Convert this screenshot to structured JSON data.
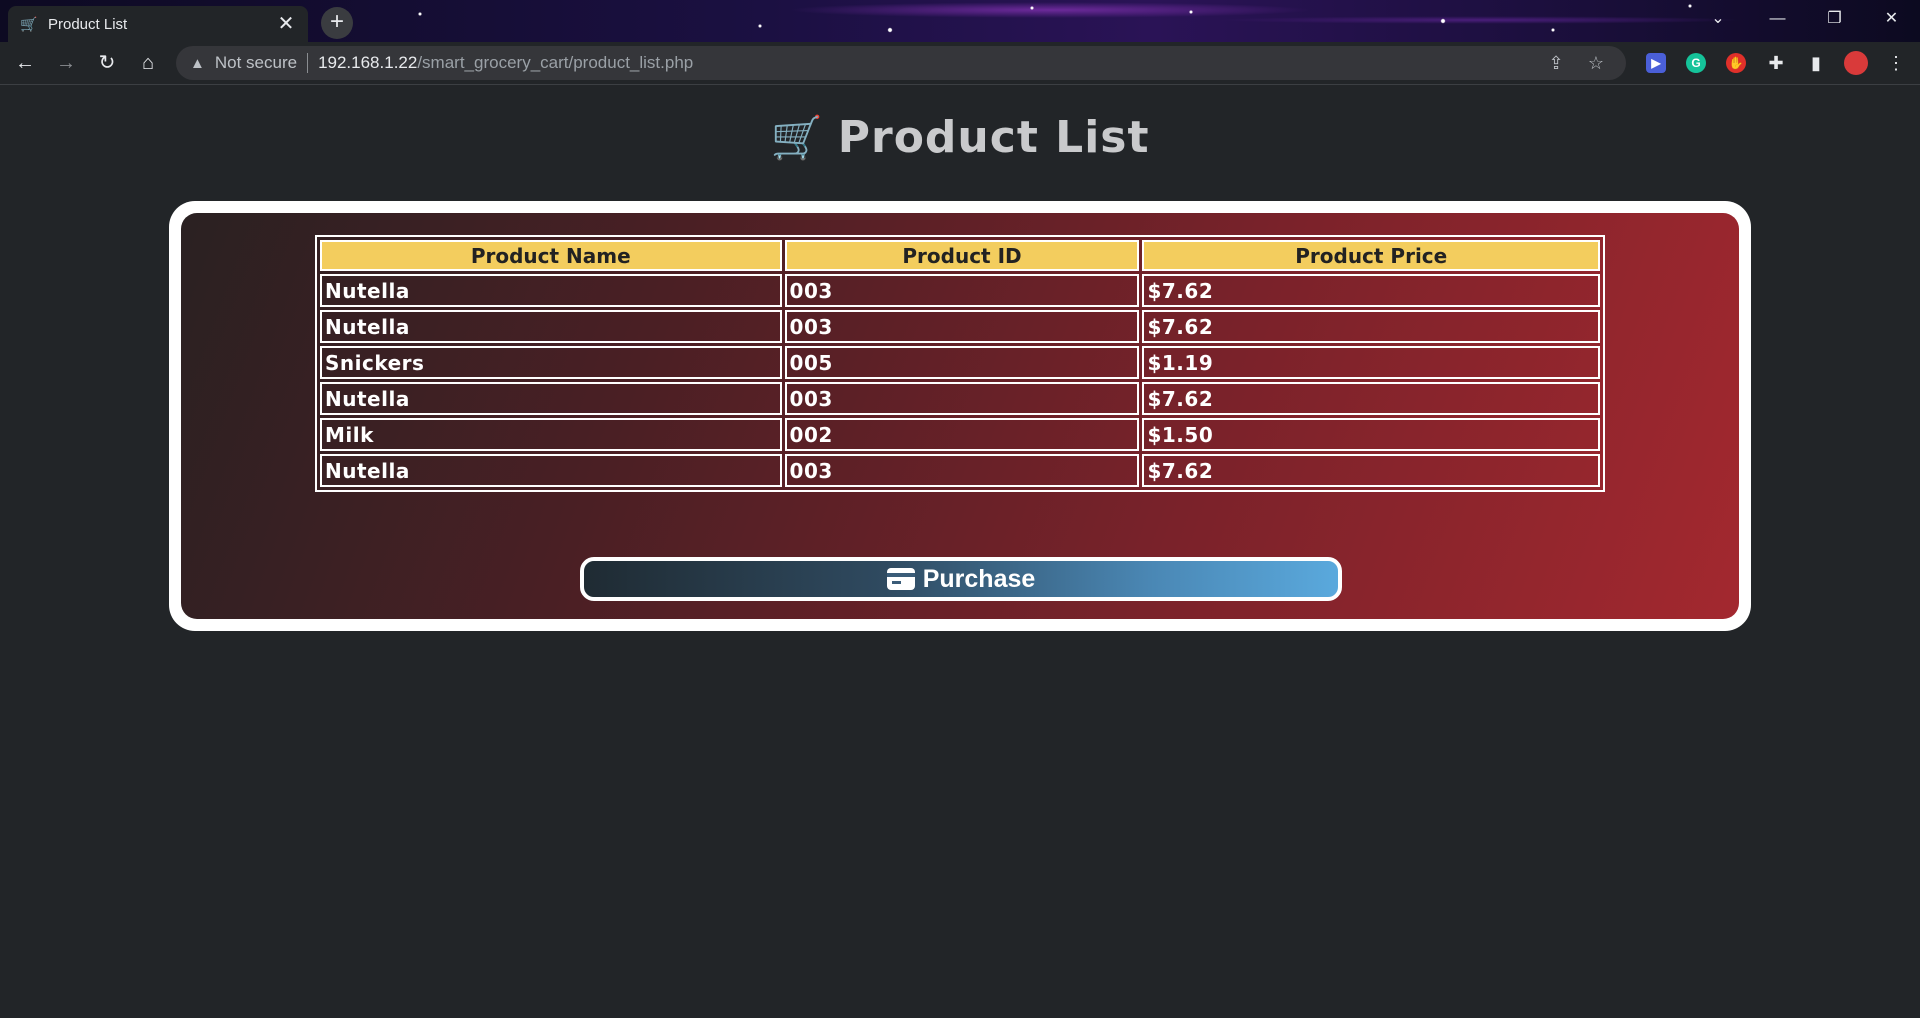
{
  "browser": {
    "tab_title": "Product List",
    "tab_close": "✕",
    "new_tab": "+",
    "not_secure": "Not secure",
    "url_host": "192.168.1.22",
    "url_path": "/smart_grocery_cart/product_list.php",
    "window_controls": {
      "tab_search": "⌄",
      "minimize": "—",
      "restore": "❐",
      "close": "✕"
    },
    "nav": {
      "back": "←",
      "forward": "→",
      "reload": "↻",
      "home": "⌂"
    }
  },
  "page": {
    "heading": "Product List",
    "table": {
      "headers": [
        "Product Name",
        "Product ID",
        "Product Price"
      ],
      "rows": [
        [
          "Nutella",
          "003",
          "$7.62"
        ],
        [
          "Nutella",
          "003",
          "$7.62"
        ],
        [
          "Snickers",
          "005",
          "$1.19"
        ],
        [
          "Nutella",
          "003",
          "$7.62"
        ],
        [
          "Milk",
          "002",
          "$1.50"
        ],
        [
          "Nutella",
          "003",
          "$7.62"
        ]
      ]
    },
    "purchase_label": "Purchase"
  },
  "colors": {
    "page_background": "#222528",
    "header_cell": "#f3cd5e",
    "card_gradient_start": "#2a2122",
    "card_gradient_end": "#a3282f",
    "button_gradient_start": "#1f2b33",
    "button_gradient_end": "#5aa9dd"
  }
}
